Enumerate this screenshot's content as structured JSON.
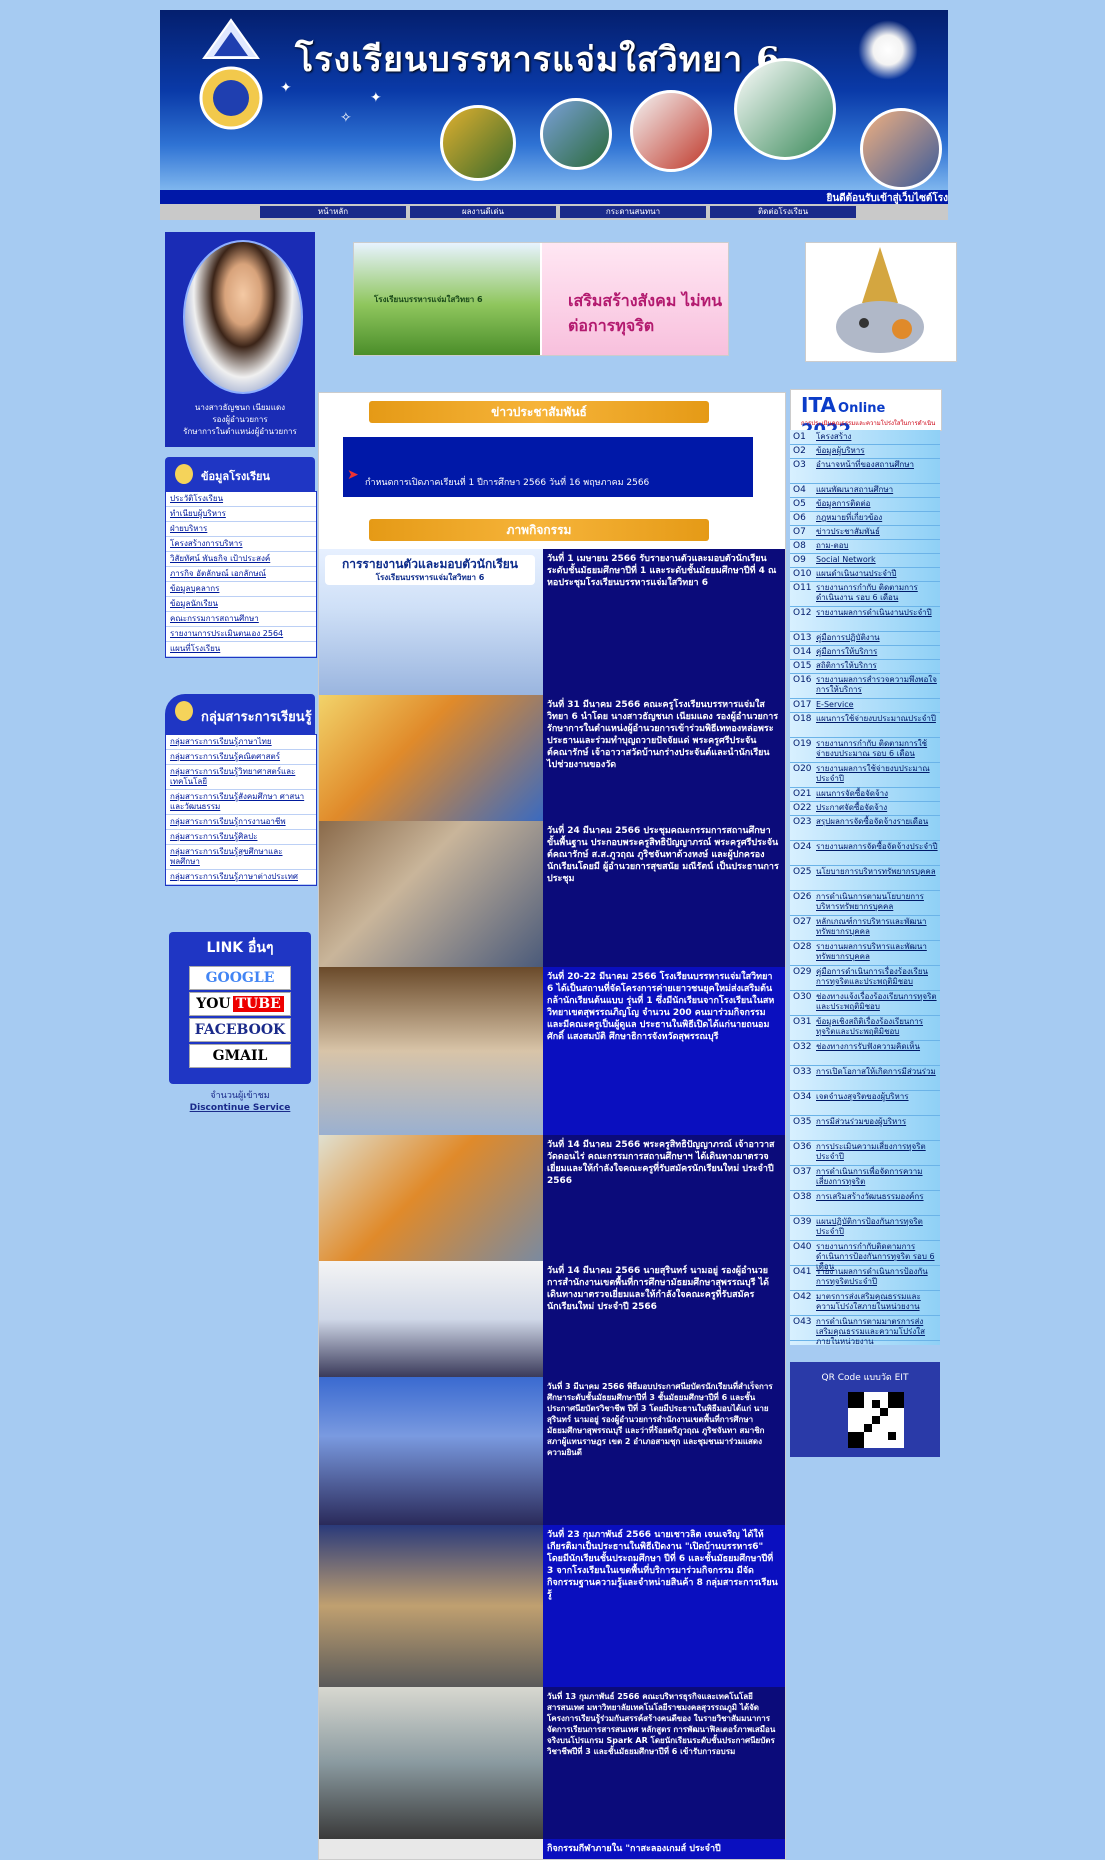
{
  "banner": {
    "title": "โรงเรียนบรรหารแจ่มใสวิทยา 6",
    "marquee": "ยินดีต้อนรับเข้าสู่เว็บไซต์โรง"
  },
  "menu": [
    "หน้าหลัก",
    "ผลงานดีเด่น",
    "กระดานสนทนา",
    "ติดต่อโรงเรียน"
  ],
  "profile": {
    "line1": "นางสาวธัญชนก เนียมแดง",
    "line2": "รองผู้อำนวยการ",
    "line3": "รักษาการในตำแหน่งผู้อำนวยการ"
  },
  "school_info": {
    "title": "ข้อมูลโรงเรียน",
    "items": [
      "ประวัติโรงเรียน",
      "ทำเนียบผู้บริหาร",
      "ฝ่ายบริหาร",
      "โครงสร้างการบริหาร",
      "วิสัยทัศน์ พันธกิจ เป้าประสงค์",
      "ภารกิจ อัตลักษณ์ เอกลักษณ์",
      "ข้อมูลบุคลากร",
      "ข้อมูลนักเรียน",
      "คณะกรรมการสถานศึกษา",
      "รายงานการประเมินตนเอง 2564",
      "แผนที่โรงเรียน"
    ]
  },
  "subjects": {
    "title": "กลุ่มสาระการเรียนรู้",
    "items": [
      "กลุ่มสาระการเรียนรู้ภาษาไทย",
      "กลุ่มสาระการเรียนรู้คณิตศาสตร์",
      "กลุ่มสาระการเรียนรู้วิทยาศาสตร์และเทคโนโลยี",
      "กลุ่มสาระการเรียนรู้สังคมศึกษา ศาสนาและวัฒนธรรม",
      "กลุ่มสาระการเรียนรู้การงานอาชีพ",
      "กลุ่มสาระการเรียนรู้ศิลปะ",
      "กลุ่มสาระการเรียนรู้สุขศึกษาและพลศึกษา",
      "กลุ่มสาระการเรียนรู้ภาษาต่างประเทศ"
    ]
  },
  "links": {
    "title": "LINK อื่นๆ",
    "google": "GOOGLE",
    "you": "YOU",
    "tube": "TUBE",
    "facebook": "FACEBOOK",
    "gmail": "GMAIL"
  },
  "counter": {
    "label": "จำนวนผู้เข้าชม",
    "link": "Discontinue Service"
  },
  "promo": {
    "left": "โรงเรียนบรรหารแจ่มใสวิทยา 6",
    "right": "เสริมสร้างสังคม ไม่ทน ต่อการทุจริต"
  },
  "news": {
    "header": "ข่าวประชาสัมพันธ์",
    "item": "กำหนดการเปิดภาคเรียนที่ 1 ปีการศึกษา 2566 วันที่ 16 พฤษภาคม 2566"
  },
  "activities": {
    "header": "ภาพกิจกรรม",
    "first_image_caption": "การรายงานตัวและมอบตัวนักเรียน",
    "first_image_sub": "โรงเรียนบรรหารแจ่มใสวิทยา 6",
    "items": [
      "วันที่ 1 เมษายน 2566 รับรายงานตัวและมอบตัวนักเรียน ระดับชั้นมัธยมศึกษาปีที่ 1 และระดับชั้นมัธยมศึกษาปีที่ 4 ณ หอประชุมโรงเรียนบรรหารแจ่มใสวิทยา 6",
      "วันที่ 31 มีนาคม 2566 คณะครูโรงเรียนบรรหารแจ่มใสวิทยา 6 นำโดย นางสาวธัญชนก เนียมแดง รองผู้อำนวยการ รักษาการในตำแหน่งผู้อำนวยการเข้าร่วมพิธีเททองหล่อพระประธานและร่วมทำบุญถวายปัจจัยแด่ พระครูศรีประจันต์คณารักษ์ เจ้าอาวาสวัดบ้านกร่างประจันต์และนำนักเรียนไปช่วยงานของวัด",
      "วันที่ 24 มีนาคม 2566 ประชุมคณะกรรมการสถานศึกษาขั้นพื้นฐาน ประกอบพระครูสิทธิปัญญาภรณ์ พระครูศรีประจันต์คณารักษ์ ส.ส.ภูวฤณ ภูริชจันทาด้วงหงษ์ และผู้ปกครองนักเรียนโดยมี ผู้อำนวยการสุขสนัย มณีรัตน์ เป็นประธานการประชุม",
      "วันที่ 20-22 มีนาคม 2566 โรงเรียนบรรหารแจ่มใสวิทยา 6 ได้เป็นสถานที่จัดโครงการค่ายเยาวชนยุคใหม่ส่งเสริมต้นกล้านักเรียนต้นแบบ รุ่นที่ 1 ซึ่งมีนักเรียนจากโรงเรียนในสหวิทยาเขตสุพรรณภิญโญ จำนวน 200 คนมาร่วมกิจกรรม และมีคณะครูเป็นผู้ดูแล ประธานในพิธีเปิดได้แก่นายถนอมศักดิ์ แสงสมบัติ ศึกษาธิการจังหวัดสุพรรณบุรี",
      "วันที่ 14 มีนาคม 2566 พระครูสิทธิปัญญาภรณ์ เจ้าอาวาสวัดดอนไร่ คณะกรรมการสถานศึกษาฯ ได้เดินทางมาตรวจเยี่ยมและให้กำลังใจคณะครูที่รับสมัครนักเรียนใหม่ ประจำปี 2566",
      "วันที่ 14 มีนาคม 2566 นายสุรินทร์ นามอยู่ รองผู้อำนวยการสำนักงานเขตพื้นที่การศึกษามัธยมศึกษาสุพรรณบุรี ได้เดินทางมาตรวจเยี่ยมและให้กำลังใจคณะครูที่รับสมัครนักเรียนใหม่ ประจำปี 2566",
      "วันที่ 3 มีนาคม 2566 พิธีมอบประกาศนียบัตรนักเรียนที่สำเร็จการศึกษาระดับชั้นมัธยมศึกษาปีที่ 3 ชั้นมัธยมศึกษาปีที่ 6 และชั้นประกาศนียบัตรวิชาชีพ ปีที่ 3 โดยมีประธานในพิธีมอบได้แก่ นายสุรินทร์ นามอยู่ รองผู้อำนวยการสำนักงานเขตพื้นที่การศึกษามัธยมศึกษาสุพรรณบุรี และว่าที่ร้อยตรีภูวฤณ ภูริชจันทา สมาชิกสภาผู้แทนราษฎร เขต 2 อำเภอสามชุก และชุมชนมาร่วมแสดงความยินดี",
      "วันที่ 23 กุมภาพันธ์ 2566 นายเชาวลิต เจนเจริญ ได้ให้เกียรติมาเป็นประธานในพิธีเปิดงาน \"เปิดบ้านบรรหาร6\" โดยมีนักเรียนชั้นประถมศึกษา ปีที่ 6 และชั้นมัธยมศึกษาปีที่ 3 จากโรงเรียนในเขตพื้นที่บริการมาร่วมกิจกรรม มีจัดกิจกรรมฐานความรู้และจำหน่ายสินค้า 8 กลุ่มสาระการเรียนรู้",
      "วันที่ 13 กุมภาพันธ์ 2566 คณะบริหารธุรกิจและเทคโนโลยีสารสนเทศ มหาวิทยาลัยเทคโนโลยีราชมงคลสุวรรณภูมิ ได้จัดโครงการเรียนรู้ร่วมกันสรรค์สร้างคนดีของ ในรายวิชาสัมมนาการจัดการเรียนการสารสนเทศ หลักสูตร การพัฒนาฟิลเตอร์ภาพเสมือนจริงบนโปรแกรม Spark AR โดยนักเรียนระดับชั้นประกาศนียบัตรวิชาชีพปีที่ 3 และชั้นมัธยมศึกษาปีที่ 6 เข้ารับการอบรม",
      "กิจกรรมกีฬาภายใน \"กาสะลองเกมส์ ประจำปี"
    ]
  },
  "ita": {
    "title_a": "ITA",
    "title_b": "Online",
    "year": "2022",
    "sub": "การประเมินคุณธรรมและความโปร่งใสในการดำเนินงานของหน่วยงานภาครัฐ",
    "items": [
      {
        "n": "O1",
        "t": "โครงสร้าง"
      },
      {
        "n": "O2",
        "t": "ข้อมูลผู้บริหาร"
      },
      {
        "n": "O3",
        "t": "อำนาจหน้าที่ของสถานศึกษา"
      },
      {
        "n": "O4",
        "t": "แผนพัฒนาสถานศึกษา"
      },
      {
        "n": "O5",
        "t": "ข้อมูลการติดต่อ"
      },
      {
        "n": "O6",
        "t": "กฎหมายที่เกี่ยวข้อง"
      },
      {
        "n": "O7",
        "t": "ข่าวประชาสัมพันธ์"
      },
      {
        "n": "O8",
        "t": "ถาม-ตอบ"
      },
      {
        "n": "O9",
        "t": "Social Network"
      },
      {
        "n": "O10",
        "t": "แผนดำเนินงานประจำปี"
      },
      {
        "n": "O11",
        "t": "รายงานการกำกับ ติดตามการดำเนินงาน รอบ 6 เดือน"
      },
      {
        "n": "O12",
        "t": "รายงานผลการดำเนินงานประจำปี"
      },
      {
        "n": "O13",
        "t": "คู่มือการปฏิบัติงาน"
      },
      {
        "n": "O14",
        "t": "คู่มือการให้บริการ"
      },
      {
        "n": "O15",
        "t": "สถิติการให้บริการ"
      },
      {
        "n": "O16",
        "t": "รายงานผลการสำรวจความพึงพอใจการให้บริการ"
      },
      {
        "n": "O17",
        "t": "E-Service"
      },
      {
        "n": "O18",
        "t": "แผนการใช้จ่ายงบประมาณประจำปี"
      },
      {
        "n": "O19",
        "t": "รายงานการกำกับ ติดตามการใช้จ่ายงบประมาณ รอบ 6 เดือน"
      },
      {
        "n": "O20",
        "t": "รายงานผลการใช้จ่ายงบประมาณประจำปี"
      },
      {
        "n": "O21",
        "t": "แผนการจัดซื้อจัดจ้าง"
      },
      {
        "n": "O22",
        "t": "ประกาศจัดซื้อจัดจ้าง"
      },
      {
        "n": "O23",
        "t": "สรุปผลการจัดซื้อจัดจ้างรายเดือน"
      },
      {
        "n": "O24",
        "t": "รายงานผลการจัดซื้อจัดจ้างประจำปี"
      },
      {
        "n": "O25",
        "t": "นโยบายการบริหารทรัพยากรบุคคล"
      },
      {
        "n": "O26",
        "t": "การดำเนินการตามนโยบายการบริหารทรัพยากรบุคคล"
      },
      {
        "n": "O27",
        "t": "หลักเกณฑ์การบริหารและพัฒนาทรัพยากรบุคคล"
      },
      {
        "n": "O28",
        "t": "รายงานผลการบริหารและพัฒนาทรัพยากรบุคคล"
      },
      {
        "n": "O29",
        "t": "คู่มือการดำเนินการเรื่องร้องเรียนการทุจริตและประพฤติมิชอบ"
      },
      {
        "n": "O30",
        "t": "ช่องทางแจ้งเรื่องร้องเรียนการทุจริตและประพฤติมิชอบ"
      },
      {
        "n": "O31",
        "t": "ข้อมูลเชิงสถิติเรื่องร้องเรียนการทุจริตและประพฤติมิชอบ"
      },
      {
        "n": "O32",
        "t": "ช่องทางการรับฟังความคิดเห็น"
      },
      {
        "n": "O33",
        "t": "การเปิดโอกาสให้เกิดการมีส่วนร่วม"
      },
      {
        "n": "O34",
        "t": "เจตจำนงสุจริตของผู้บริหาร"
      },
      {
        "n": "O35",
        "t": "การมีส่วนร่วมของผู้บริหาร"
      },
      {
        "n": "O36",
        "t": "การประเมินความเสี่ยงการทุจริตประจำปี"
      },
      {
        "n": "O37",
        "t": "การดำเนินการเพื่อจัดการความเสี่ยงการทุจริต"
      },
      {
        "n": "O38",
        "t": "การเสริมสร้างวัฒนธรรมองค์กร"
      },
      {
        "n": "O39",
        "t": "แผนปฏิบัติการป้องกันการทุจริตประจำปี"
      },
      {
        "n": "O40",
        "t": "รายงานการกำกับติดตามการดำเนินการป้องกันการทุจริต รอบ 6 เดือน"
      },
      {
        "n": "O41",
        "t": "รายงานผลการดำเนินการป้องกันการทุจริตประจำปี"
      },
      {
        "n": "O42",
        "t": "มาตรการส่งเสริมคุณธรรมและความโปร่งใสภายในหน่วยงาน"
      },
      {
        "n": "O43",
        "t": "การดำเนินการตามมาตรการส่งเสริมคุณธรรมและความโปร่งใสภายในหน่วยงาน"
      }
    ]
  },
  "qr": {
    "label": "QR Code แบบวัด EIT"
  }
}
